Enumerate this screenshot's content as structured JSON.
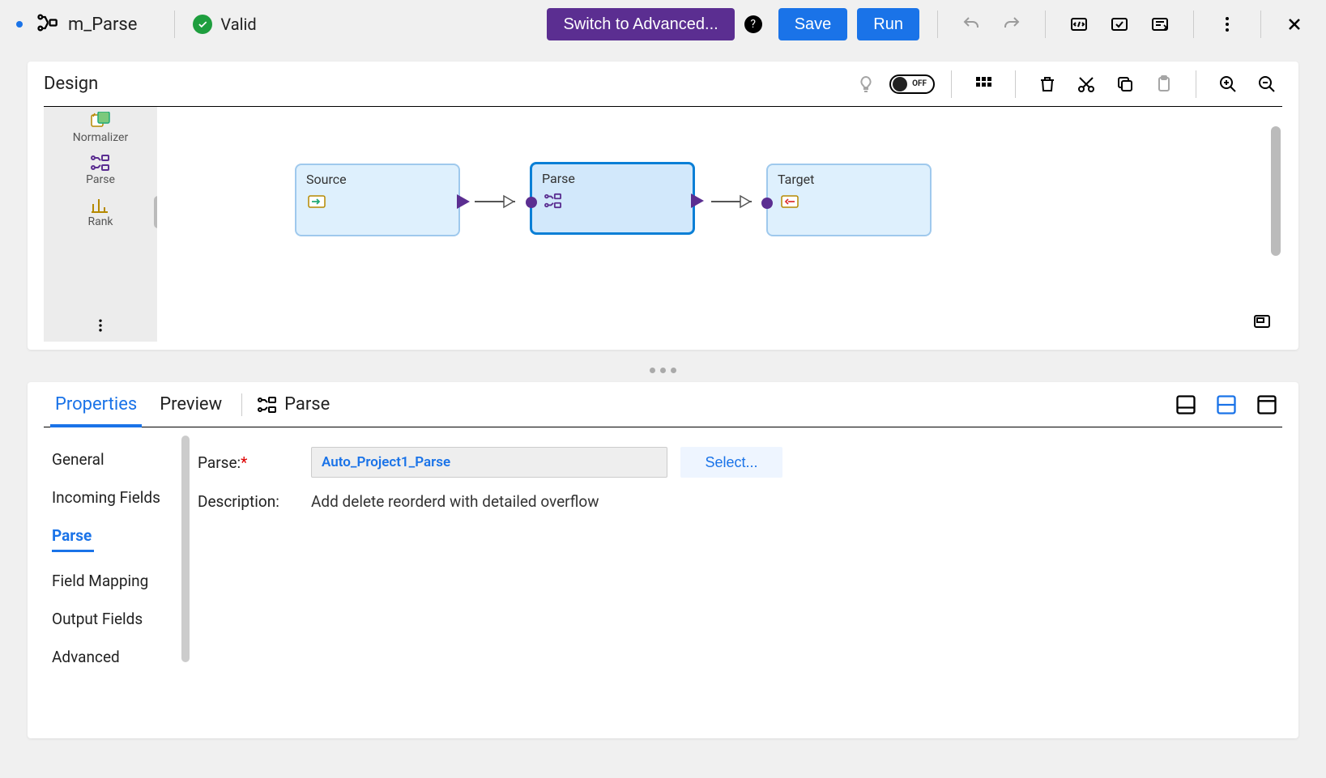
{
  "header": {
    "title": "m_Parse",
    "status_text": "Valid",
    "switch_label": "Switch to Advanced...",
    "save_label": "Save",
    "run_label": "Run"
  },
  "design": {
    "title": "Design",
    "toggle_label": "OFF",
    "palette": [
      {
        "label": "Normalizer",
        "icon": "normalizer"
      },
      {
        "label": "Parse",
        "icon": "parse"
      },
      {
        "label": "Rank",
        "icon": "rank"
      }
    ],
    "nodes": {
      "source": {
        "label": "Source"
      },
      "parse": {
        "label": "Parse"
      },
      "target": {
        "label": "Target"
      }
    }
  },
  "props": {
    "tabs": {
      "properties": "Properties",
      "preview": "Preview"
    },
    "crumb": "Parse",
    "side_tabs": [
      "General",
      "Incoming Fields",
      "Parse",
      "Field Mapping",
      "Output Fields",
      "Advanced"
    ],
    "active_side_tab": 2,
    "form": {
      "parse_label": "Parse:",
      "parse_value": "Auto_Project1_Parse",
      "select_label": "Select...",
      "desc_label": "Description:",
      "desc_value": "Add delete reorderd with detailed overflow"
    }
  }
}
